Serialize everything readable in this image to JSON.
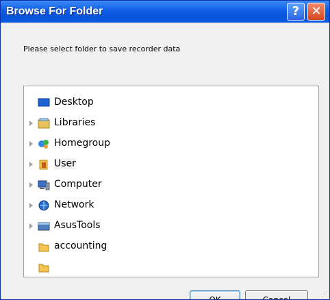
{
  "window": {
    "title": "Browse For Folder"
  },
  "prompt": "Please select folder to save recorder data",
  "tree": [
    {
      "label": "Desktop",
      "icon": "desktop-icon",
      "expandable": false
    },
    {
      "label": "Libraries",
      "icon": "libraries-icon",
      "expandable": true
    },
    {
      "label": "Homegroup",
      "icon": "homegroup-icon",
      "expandable": true
    },
    {
      "label": "User",
      "icon": "user-folder-icon",
      "expandable": true,
      "selected": true
    },
    {
      "label": "Computer",
      "icon": "computer-icon",
      "expandable": true
    },
    {
      "label": "Network",
      "icon": "network-icon",
      "expandable": true
    },
    {
      "label": "AsusTools",
      "icon": "asustools-icon",
      "expandable": true
    },
    {
      "label": "accounting",
      "icon": "folder-icon",
      "expandable": false
    }
  ],
  "buttons": {
    "ok": "OK",
    "cancel": "Cancel"
  },
  "colors": {
    "titlebar": "#0854d9",
    "close": "#d8461e",
    "help": "#2a66e6"
  }
}
